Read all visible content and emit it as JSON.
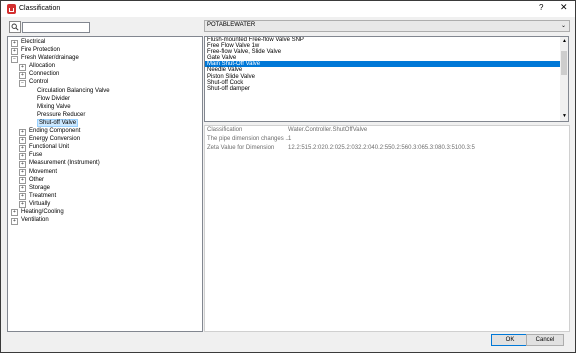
{
  "window": {
    "title": "Classification",
    "help_label": "?",
    "close_label": "✕"
  },
  "tree": [
    {
      "label": "Electrical",
      "level": 0,
      "expander": "+"
    },
    {
      "label": "Fire Protection",
      "level": 0,
      "expander": "+"
    },
    {
      "label": "Fresh Water/drainage",
      "level": 0,
      "expander": "−"
    },
    {
      "label": "Allocation",
      "level": 1,
      "expander": "+"
    },
    {
      "label": "Connection",
      "level": 1,
      "expander": "+"
    },
    {
      "label": "Control",
      "level": 1,
      "expander": "−"
    },
    {
      "label": "Circulation Balancing Valve",
      "level": 2,
      "expander": ""
    },
    {
      "label": "Flow Divider",
      "level": 2,
      "expander": ""
    },
    {
      "label": "Mixing Valve",
      "level": 2,
      "expander": ""
    },
    {
      "label": "Pressure Reducer",
      "level": 2,
      "expander": ""
    },
    {
      "label": "Shut-off Valve",
      "level": 2,
      "expander": "",
      "selected": true
    },
    {
      "label": "Ending Component",
      "level": 1,
      "expander": "+"
    },
    {
      "label": "Energy Conversion",
      "level": 1,
      "expander": "+"
    },
    {
      "label": "Functional Unit",
      "level": 1,
      "expander": "+"
    },
    {
      "label": "Fuse",
      "level": 1,
      "expander": "+"
    },
    {
      "label": "Measurement (Instrument)",
      "level": 1,
      "expander": "+"
    },
    {
      "label": "Movement",
      "level": 1,
      "expander": "+"
    },
    {
      "label": "Other",
      "level": 1,
      "expander": "+"
    },
    {
      "label": "Storage",
      "level": 1,
      "expander": "+"
    },
    {
      "label": "Treatment",
      "level": 1,
      "expander": "+"
    },
    {
      "label": "Virtually",
      "level": 1,
      "expander": "+"
    },
    {
      "label": "Heating/Cooling",
      "level": 0,
      "expander": "+"
    },
    {
      "label": "Ventilation",
      "level": 0,
      "expander": "+"
    }
  ],
  "medium_dropdown": {
    "value": "POTABLEWATER",
    "arrow": "⌄"
  },
  "valve_list": [
    {
      "label": "Flush-mounted Free-flow Valve SNP"
    },
    {
      "label": "Free Flow Valve 1w"
    },
    {
      "label": "Free-flow Valve, Slide Valve"
    },
    {
      "label": "Gate Valve"
    },
    {
      "label": "Main Shut-Off Valve",
      "selected": true
    },
    {
      "label": "Needle Valve"
    },
    {
      "label": "Piston Slide Valve"
    },
    {
      "label": "Shut-off Cock"
    },
    {
      "label": "Shut-off damper"
    }
  ],
  "properties": [
    {
      "name": "Classification",
      "value": "Water.Controller.ShutOffValve"
    },
    {
      "name": "The pipe dimension changes ...",
      "value": "1"
    },
    {
      "name": "Zeta Value for Dimension",
      "value": "12.2:515.2:020.2:025.2:032.2:040.2:550.2:560.3:065.3:080.3:5100.3:5"
    }
  ],
  "buttons": {
    "ok": "OK",
    "cancel": "Cancel"
  }
}
